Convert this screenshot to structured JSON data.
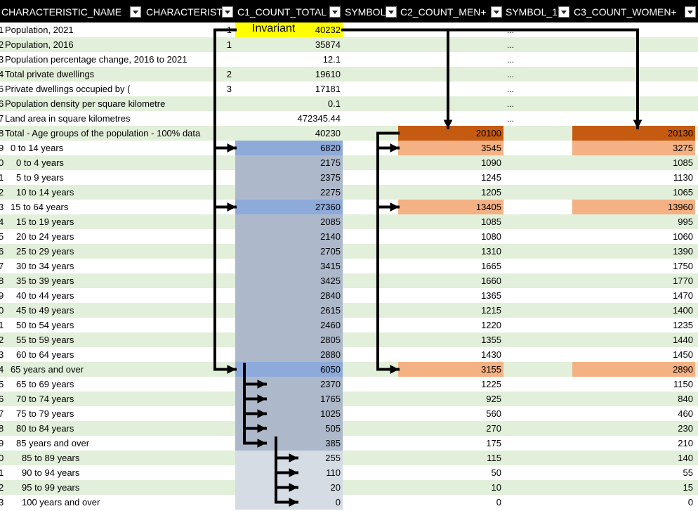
{
  "headers": {
    "name": "CHARACTERISTIC_NAME",
    "char": "CHARACTERISTI",
    "total": "C1_COUNT_TOTAL",
    "symbol": "SYMBOL",
    "men": "C2_COUNT_MEN+",
    "symbol1": "SYMBOL_1",
    "women": "C3_COUNT_WOMEN+"
  },
  "invariant_label": "Invariant",
  "rows": [
    {
      "idx": "1",
      "name": "Population, 2021",
      "indent": 0,
      "char": "1",
      "total": "40232",
      "sym": "...",
      "men": "",
      "women": "",
      "band": false,
      "fill_total": "yellow",
      "fill_men": "",
      "fill_women": ""
    },
    {
      "idx": "2",
      "name": "Population, 2016",
      "indent": 0,
      "char": "1",
      "total": "35874",
      "sym": "...",
      "men": "",
      "women": "",
      "band": true,
      "fill_total": "",
      "fill_men": "",
      "fill_women": ""
    },
    {
      "idx": "3",
      "name": "Population percentage change, 2016 to 2021",
      "indent": 0,
      "char": "",
      "total": "12.1",
      "sym": "...",
      "men": "",
      "women": "",
      "band": false,
      "fill_total": "",
      "fill_men": "",
      "fill_women": ""
    },
    {
      "idx": "4",
      "name": "Total private dwellings",
      "indent": 0,
      "char": "2",
      "total": "19610",
      "sym": "...",
      "men": "",
      "women": "",
      "band": true,
      "fill_total": "",
      "fill_men": "",
      "fill_women": ""
    },
    {
      "idx": "5",
      "name": "Private dwellings occupied by (",
      "indent": 0,
      "char": "3",
      "total": "17181",
      "sym": "...",
      "men": "",
      "women": "",
      "band": false,
      "fill_total": "",
      "fill_men": "",
      "fill_women": ""
    },
    {
      "idx": "6",
      "name": "Population density per square kilometre",
      "indent": 0,
      "char": "",
      "total": "0.1",
      "sym": "...",
      "men": "",
      "women": "",
      "band": true,
      "fill_total": "",
      "fill_men": "",
      "fill_women": ""
    },
    {
      "idx": "7",
      "name": "Land area in square kilometres",
      "indent": 0,
      "char": "",
      "total": "472345.44",
      "sym": "...",
      "men": "",
      "women": "",
      "band": false,
      "fill_total": "",
      "fill_men": "",
      "fill_women": ""
    },
    {
      "idx": "8",
      "name": "Total - Age groups of the population - 100% data",
      "indent": 0,
      "char": "",
      "total": "40230",
      "sym": "",
      "men": "20100",
      "women": "20130",
      "band": true,
      "fill_total": "",
      "fill_men": "dorange",
      "fill_women": "dorange"
    },
    {
      "idx": "9",
      "name": "0 to 14 years",
      "indent": 1,
      "char": "",
      "total": "6820",
      "sym": "",
      "men": "3545",
      "women": "3275",
      "band": false,
      "fill_total": "blue",
      "fill_men": "lorange",
      "fill_women": "lorange"
    },
    {
      "idx": "0",
      "name": "0 to 4 years",
      "indent": 2,
      "char": "",
      "total": "2175",
      "sym": "",
      "men": "1090",
      "women": "1085",
      "band": true,
      "fill_total": "gray",
      "fill_men": "",
      "fill_women": ""
    },
    {
      "idx": "1",
      "name": "5 to 9 years",
      "indent": 2,
      "char": "",
      "total": "2375",
      "sym": "",
      "men": "1245",
      "women": "1130",
      "band": false,
      "fill_total": "gray",
      "fill_men": "",
      "fill_women": ""
    },
    {
      "idx": "2",
      "name": "10 to 14 years",
      "indent": 2,
      "char": "",
      "total": "2275",
      "sym": "",
      "men": "1205",
      "women": "1065",
      "band": true,
      "fill_total": "gray",
      "fill_men": "",
      "fill_women": ""
    },
    {
      "idx": "3",
      "name": "15 to 64 years",
      "indent": 1,
      "char": "",
      "total": "27360",
      "sym": "",
      "men": "13405",
      "women": "13960",
      "band": false,
      "fill_total": "blue",
      "fill_men": "lorange",
      "fill_women": "lorange"
    },
    {
      "idx": "4",
      "name": "15 to 19 years",
      "indent": 2,
      "char": "",
      "total": "2085",
      "sym": "",
      "men": "1085",
      "women": "995",
      "band": true,
      "fill_total": "gray",
      "fill_men": "",
      "fill_women": ""
    },
    {
      "idx": "5",
      "name": "20 to 24 years",
      "indent": 2,
      "char": "",
      "total": "2140",
      "sym": "",
      "men": "1080",
      "women": "1060",
      "band": false,
      "fill_total": "gray",
      "fill_men": "",
      "fill_women": ""
    },
    {
      "idx": "6",
      "name": "25 to 29 years",
      "indent": 2,
      "char": "",
      "total": "2705",
      "sym": "",
      "men": "1310",
      "women": "1390",
      "band": true,
      "fill_total": "gray",
      "fill_men": "",
      "fill_women": ""
    },
    {
      "idx": "7",
      "name": "30 to 34 years",
      "indent": 2,
      "char": "",
      "total": "3415",
      "sym": "",
      "men": "1665",
      "women": "1750",
      "band": false,
      "fill_total": "gray",
      "fill_men": "",
      "fill_women": ""
    },
    {
      "idx": "8",
      "name": "35 to 39 years",
      "indent": 2,
      "char": "",
      "total": "3425",
      "sym": "",
      "men": "1660",
      "women": "1770",
      "band": true,
      "fill_total": "gray",
      "fill_men": "",
      "fill_women": ""
    },
    {
      "idx": "9",
      "name": "40 to 44 years",
      "indent": 2,
      "char": "",
      "total": "2840",
      "sym": "",
      "men": "1365",
      "women": "1470",
      "band": false,
      "fill_total": "gray",
      "fill_men": "",
      "fill_women": ""
    },
    {
      "idx": "0",
      "name": "45 to 49 years",
      "indent": 2,
      "char": "",
      "total": "2615",
      "sym": "",
      "men": "1215",
      "women": "1400",
      "band": true,
      "fill_total": "gray",
      "fill_men": "",
      "fill_women": ""
    },
    {
      "idx": "1",
      "name": "50 to 54 years",
      "indent": 2,
      "char": "",
      "total": "2460",
      "sym": "",
      "men": "1220",
      "women": "1235",
      "band": false,
      "fill_total": "gray",
      "fill_men": "",
      "fill_women": ""
    },
    {
      "idx": "2",
      "name": "55 to 59 years",
      "indent": 2,
      "char": "",
      "total": "2805",
      "sym": "",
      "men": "1355",
      "women": "1440",
      "band": true,
      "fill_total": "gray",
      "fill_men": "",
      "fill_women": ""
    },
    {
      "idx": "3",
      "name": "60 to 64 years",
      "indent": 2,
      "char": "",
      "total": "2880",
      "sym": "",
      "men": "1430",
      "women": "1450",
      "band": false,
      "fill_total": "gray",
      "fill_men": "",
      "fill_women": ""
    },
    {
      "idx": "4",
      "name": "65 years and over",
      "indent": 1,
      "char": "",
      "total": "6050",
      "sym": "",
      "men": "3155",
      "women": "2890",
      "band": true,
      "fill_total": "blue",
      "fill_men": "lorange",
      "fill_women": "lorange"
    },
    {
      "idx": "5",
      "name": "65 to 69 years",
      "indent": 2,
      "char": "",
      "total": "2370",
      "sym": "",
      "men": "1225",
      "women": "1150",
      "band": false,
      "fill_total": "gray",
      "fill_men": "",
      "fill_women": ""
    },
    {
      "idx": "6",
      "name": "70 to 74 years",
      "indent": 2,
      "char": "",
      "total": "1765",
      "sym": "",
      "men": "925",
      "women": "840",
      "band": true,
      "fill_total": "gray",
      "fill_men": "",
      "fill_women": ""
    },
    {
      "idx": "7",
      "name": "75 to 79 years",
      "indent": 2,
      "char": "",
      "total": "1025",
      "sym": "",
      "men": "560",
      "women": "460",
      "band": false,
      "fill_total": "gray",
      "fill_men": "",
      "fill_women": ""
    },
    {
      "idx": "8",
      "name": "80 to 84 years",
      "indent": 2,
      "char": "",
      "total": "505",
      "sym": "",
      "men": "270",
      "women": "230",
      "band": true,
      "fill_total": "gray",
      "fill_men": "",
      "fill_women": ""
    },
    {
      "idx": "9",
      "name": "85 years and over",
      "indent": 2,
      "char": "",
      "total": "385",
      "sym": "",
      "men": "175",
      "women": "210",
      "band": false,
      "fill_total": "gray",
      "fill_men": "",
      "fill_women": ""
    },
    {
      "idx": "0",
      "name": "85 to 89 years",
      "indent": 3,
      "char": "",
      "total": "255",
      "sym": "",
      "men": "115",
      "women": "140",
      "band": true,
      "fill_total": "lgray",
      "fill_men": "",
      "fill_women": ""
    },
    {
      "idx": "1",
      "name": "90 to 94 years",
      "indent": 3,
      "char": "",
      "total": "110",
      "sym": "",
      "men": "50",
      "women": "55",
      "band": false,
      "fill_total": "lgray",
      "fill_men": "",
      "fill_women": ""
    },
    {
      "idx": "2",
      "name": "95 to 99 years",
      "indent": 3,
      "char": "",
      "total": "20",
      "sym": "",
      "men": "10",
      "women": "15",
      "band": true,
      "fill_total": "lgray",
      "fill_men": "",
      "fill_women": ""
    },
    {
      "idx": "3",
      "name": "100 years and over",
      "indent": 3,
      "char": "",
      "total": "0",
      "sym": "",
      "men": "0",
      "women": "0",
      "band": false,
      "fill_total": "lgray",
      "fill_men": "",
      "fill_women": ""
    }
  ],
  "colors": {
    "header_bg": "#000000",
    "band": "#e2efda",
    "blue": "#8eaadb",
    "gray": "#adb9ca",
    "lgray": "#d6dce4",
    "dorange": "#c55a11",
    "lorange": "#f4b183",
    "yellow": "#ffff00",
    "arrow": "#000000"
  }
}
